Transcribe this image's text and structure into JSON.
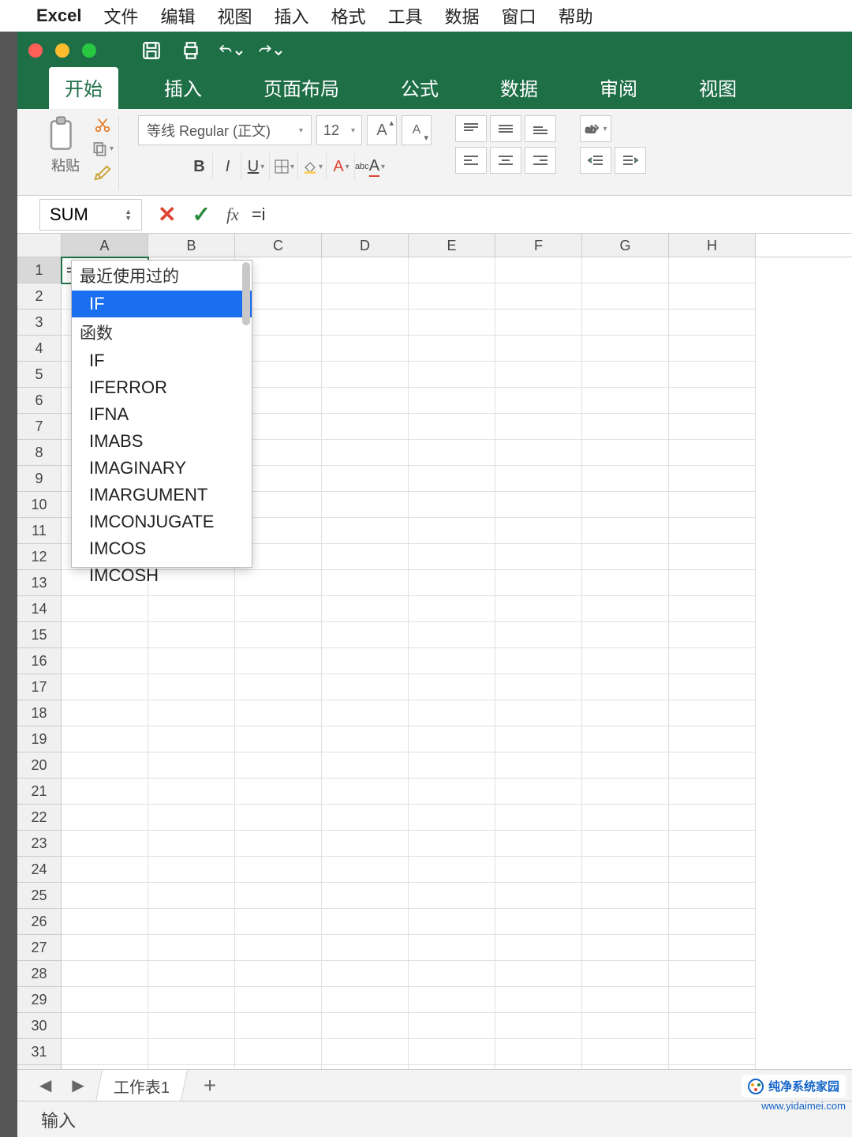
{
  "mac_menu": {
    "app": "Excel",
    "items": [
      "文件",
      "编辑",
      "视图",
      "插入",
      "格式",
      "工具",
      "数据",
      "窗口",
      "帮助"
    ]
  },
  "ribbon_tabs": [
    "开始",
    "插入",
    "页面布局",
    "公式",
    "数据",
    "审阅",
    "视图"
  ],
  "active_ribbon_tab": 0,
  "clipboard": {
    "paste": "粘贴"
  },
  "font": {
    "name": "等线 Regular (正文)",
    "size": "12"
  },
  "name_box": "SUM",
  "formula_input": "=i",
  "active_cell_value": "=i",
  "columns": [
    "A",
    "B",
    "C",
    "D",
    "E",
    "F",
    "G",
    "H"
  ],
  "row_count": 32,
  "active_cell": {
    "row": 1,
    "col": "A"
  },
  "autocomplete": {
    "recent_header": "最近使用过的",
    "selected": "IF",
    "func_header": "函数",
    "items": [
      "IF",
      "IFERROR",
      "IFNA",
      "IMABS",
      "IMAGINARY",
      "IMARGUMENT",
      "IMCONJUGATE",
      "IMCOS",
      "IMCOSH"
    ]
  },
  "sheet_tab": "工作表1",
  "status_text": "输入",
  "watermark": {
    "text": "纯净系统家园",
    "url": "www.yidaimei.com"
  }
}
